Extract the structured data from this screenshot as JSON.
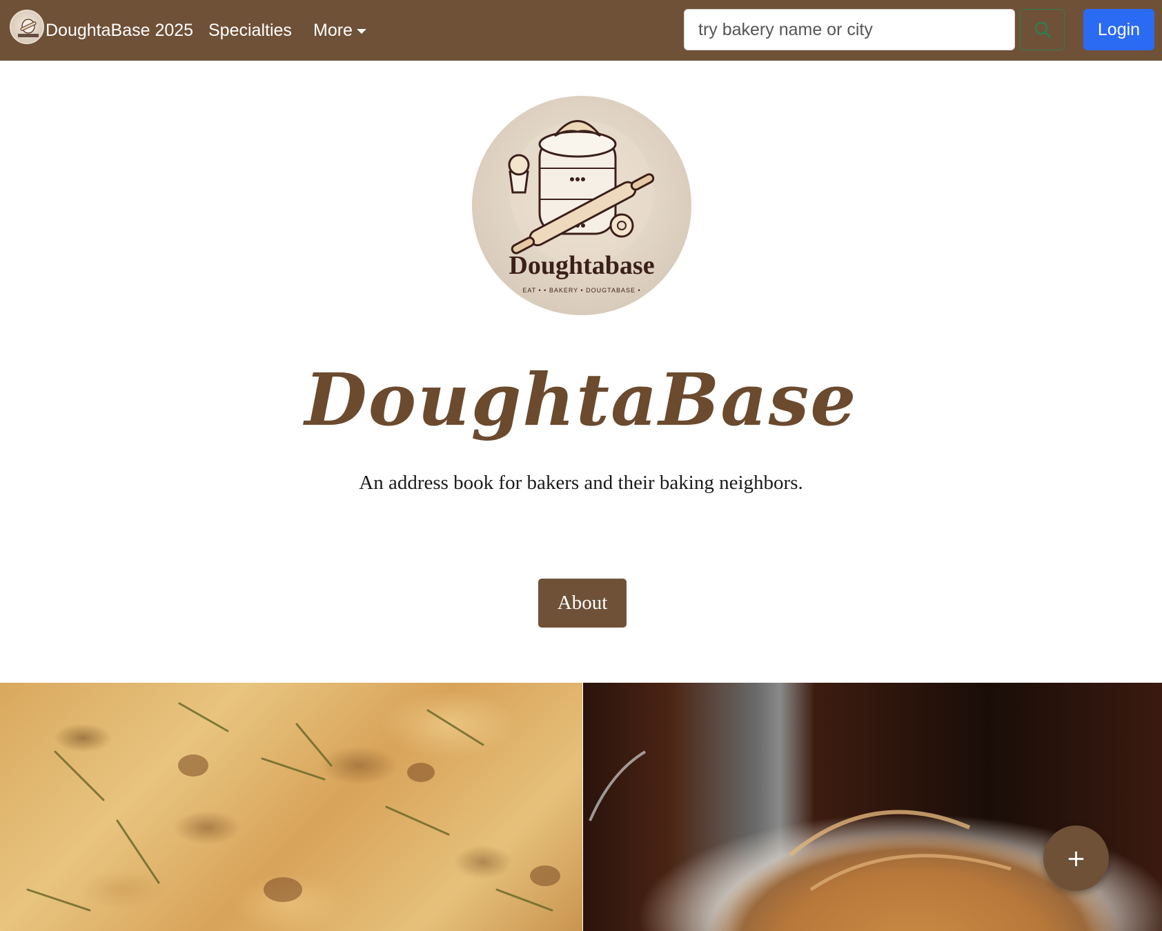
{
  "navbar": {
    "brand_title": "DoughtaBase 2025",
    "links": {
      "specialties": "Specialties",
      "more": "More"
    },
    "search": {
      "placeholder": "try bakery name or city",
      "icon": "search-icon"
    },
    "login_label": "Login"
  },
  "hero": {
    "logo_word": "Doughtabase",
    "logo_tagline": "EAT • • BAKERY • DOUGTABASE •",
    "title": "DoughtaBase",
    "subtitle": "An address book for bakers and their baking neighbors.",
    "about_label": "About"
  },
  "photos": [
    "focaccia-photo",
    "bread-loaf-photo"
  ],
  "fab": {
    "label": "+",
    "icon": "plus-icon"
  },
  "colors": {
    "brand_brown": "#6f5138",
    "login_blue": "#2b6af3",
    "search_border": "#2f7d4f",
    "title_brown": "#6b4a2e"
  }
}
